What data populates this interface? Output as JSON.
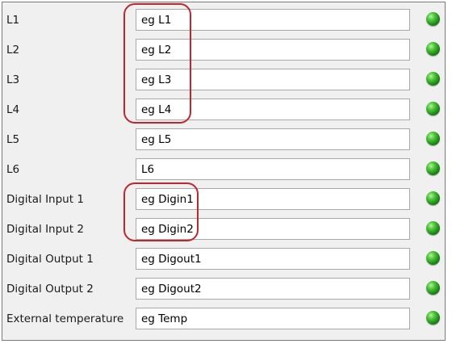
{
  "rows": [
    {
      "label": "L1",
      "value": "eg L1",
      "status": "green-led-icon"
    },
    {
      "label": "L2",
      "value": "eg L2",
      "status": "green-led-icon"
    },
    {
      "label": "L3",
      "value": "eg L3",
      "status": "green-led-icon"
    },
    {
      "label": "L4",
      "value": "eg L4",
      "status": "green-led-icon"
    },
    {
      "label": "L5",
      "value": "eg L5",
      "status": "green-led-icon"
    },
    {
      "label": "L6",
      "value": "L6",
      "status": "green-led-icon"
    },
    {
      "label": "Digital Input 1",
      "value": "eg Digin1",
      "status": "green-led-icon"
    },
    {
      "label": "Digital Input 2",
      "value": "eg Digin2",
      "status": "green-led-icon"
    },
    {
      "label": "Digital Output 1",
      "value": "eg Digout1",
      "status": "green-led-icon"
    },
    {
      "label": "Digital Output 2",
      "value": "eg Digout2",
      "status": "green-led-icon"
    },
    {
      "label": "External temperature",
      "value": "eg Temp",
      "status": "green-led-icon"
    }
  ],
  "colors": {
    "panel_bg": "#f0f0f0",
    "led_green": "#1f8a18",
    "highlight_red": "#c0262c"
  }
}
